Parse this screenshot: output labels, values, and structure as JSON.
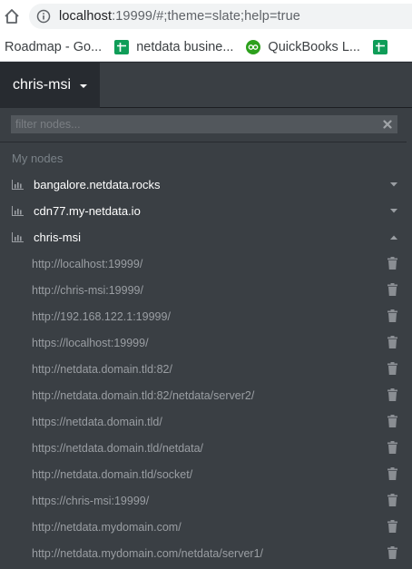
{
  "browser": {
    "url_host": "localhost",
    "url_rest": ":19999/#;theme=slate;help=true",
    "bookmarks": [
      {
        "label": "Roadmap - Go...",
        "icon": "bookmark-placeholder-icon"
      },
      {
        "label": "netdata busine...",
        "icon": "sheets-icon",
        "color": "#0f9d58"
      },
      {
        "label": "QuickBooks L...",
        "icon": "quickbooks-icon",
        "color": "#2ca01c"
      }
    ]
  },
  "navbar": {
    "node_name": "chris-msi"
  },
  "dropdown": {
    "filter_placeholder": "filter nodes...",
    "section_title": "My nodes",
    "nodes": [
      {
        "name": "bangalore.netdata.rocks",
        "expanded": false
      },
      {
        "name": "cdn77.my-netdata.io",
        "expanded": false
      },
      {
        "name": "chris-msi",
        "expanded": true
      }
    ],
    "urls": [
      "http://localhost:19999/",
      "http://chris-msi:19999/",
      "http://192.168.122.1:19999/",
      "https://localhost:19999/",
      "http://netdata.domain.tld:82/",
      "http://netdata.domain.tld:82/netdata/server2/",
      "https://netdata.domain.tld/",
      "https://netdata.domain.tld/netdata/",
      "http://netdata.domain.tld/socket/",
      "https://chris-msi:19999/",
      "http://netdata.mydomain.com/",
      "http://netdata.mydomain.com/netdata/server1/"
    ]
  },
  "colors": {
    "navbar_bg": "#3a3f44",
    "body_bg": "#272b30",
    "muted_text": "#7a8288",
    "url_text": "#9a9ea3"
  }
}
